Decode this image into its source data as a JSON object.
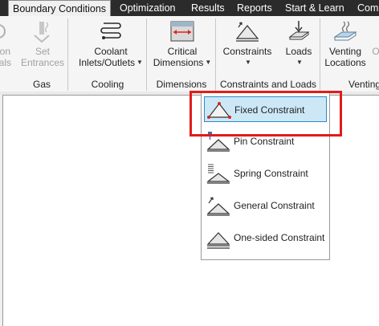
{
  "tabs": [
    {
      "label": "Boundary Conditions",
      "active": true
    },
    {
      "label": "Optimization"
    },
    {
      "label": "Results"
    },
    {
      "label": "Reports"
    },
    {
      "label": "Start & Learn"
    },
    {
      "label": "Comp"
    }
  ],
  "ribbon": {
    "buttons": {
      "materials": {
        "line1": "ion",
        "line2": "ials"
      },
      "set_entrances": {
        "line1": "Set",
        "line2": "Entrances"
      },
      "coolant": {
        "line1": "Coolant",
        "line2": "Inlets/Outlets"
      },
      "critical": {
        "line1": "Critical",
        "line2": "Dimensions"
      },
      "constraints": {
        "line1": "Constraints"
      },
      "loads": {
        "line1": "Loads"
      },
      "venting": {
        "line1": "Venting",
        "line2": "Locations"
      },
      "other": {
        "line1": "O"
      }
    },
    "groups": {
      "gas": "Gas",
      "cooling": "Cooling",
      "dimensions": "Dimensions",
      "constraints_loads": "Constraints and Loads",
      "venting": "Venting"
    }
  },
  "menu": {
    "items": [
      {
        "label": "Fixed Constraint",
        "highlighted": true
      },
      {
        "label": "Pin Constraint"
      },
      {
        "label": "Spring Constraint"
      },
      {
        "label": "General Constraint"
      },
      {
        "label": "One-sided Constraint"
      }
    ]
  },
  "colors": {
    "tab_bar": "#2b2b2b",
    "highlight_fill": "#cce8f7",
    "highlight_border": "#2c8ac9",
    "annotation_red": "#e11b1b"
  }
}
